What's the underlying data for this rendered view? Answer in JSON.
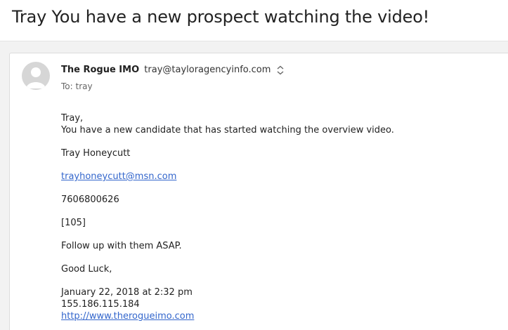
{
  "subject": "Tray You have a new prospect watching the video!",
  "header": {
    "sender_name": "The Rogue IMO",
    "sender_email": "tray@tayloragencyinfo.com",
    "to": "To: tray"
  },
  "body": {
    "greeting": "Tray,",
    "intro": "You have a new candidate that has started watching the overview video.",
    "candidate_name": "Tray Honeycutt",
    "candidate_email": "trayhoneycutt@msn.com",
    "candidate_phone": "7606800626",
    "code": "[105]",
    "instruction": "Follow up with them ASAP.",
    "closing": "Good Luck,",
    "timestamp": "January 22, 2018 at 2:32 pm",
    "ip": "155.186.115.184",
    "site_link": "http://www.therogueimo.com"
  },
  "colors": {
    "link": "#3366cc",
    "avatar": "#d6d6d6"
  },
  "icons": {
    "avatar": "person-icon",
    "expand": "chevron-up-down-icon"
  }
}
